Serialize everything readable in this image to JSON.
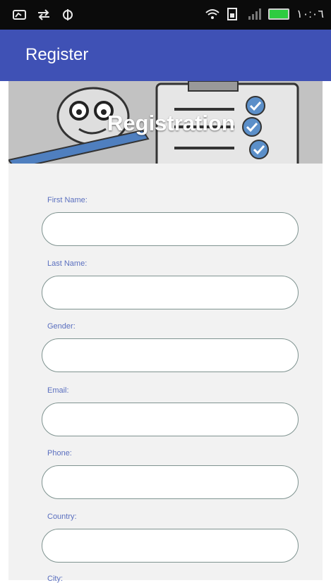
{
  "status_bar": {
    "time": "١٠:٠٦",
    "left_icons": [
      "message-icon",
      "usb-icon",
      "android-debug-icon"
    ],
    "right_icons": [
      "wifi-icon",
      "sim-icon",
      "signal-icon",
      "battery-icon"
    ]
  },
  "app_bar": {
    "title": "Register",
    "color": "#3f51b5"
  },
  "banner": {
    "title": "Registration"
  },
  "form": {
    "fields": [
      {
        "label": "First Name:",
        "value": "",
        "placeholder": ""
      },
      {
        "label": "Last Name:",
        "value": "",
        "placeholder": ""
      },
      {
        "label": "Gender:",
        "value": "",
        "placeholder": ""
      },
      {
        "label": "Email:",
        "value": "",
        "placeholder": ""
      },
      {
        "label": "Phone:",
        "value": "",
        "placeholder": ""
      },
      {
        "label": "Country:",
        "value": "",
        "placeholder": ""
      },
      {
        "label": "City:"
      }
    ]
  }
}
